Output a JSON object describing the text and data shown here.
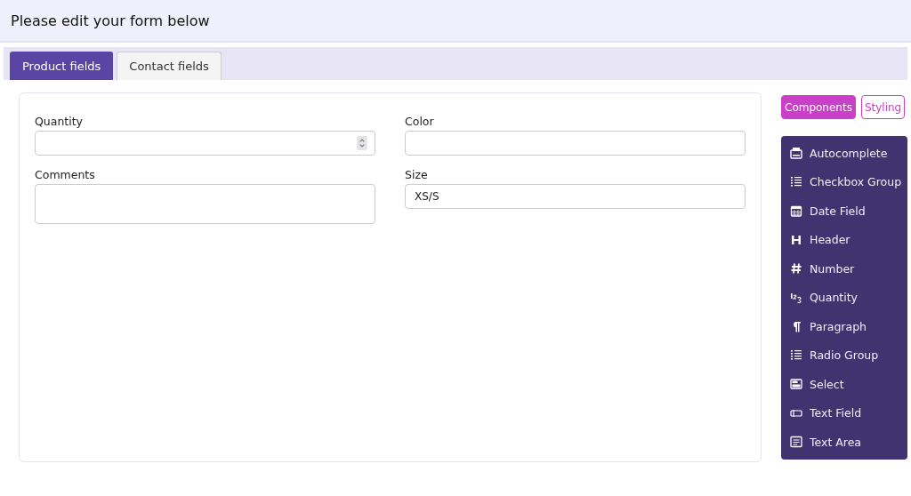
{
  "header": {
    "title": "Please edit your form below"
  },
  "tabs": [
    {
      "label": "Product fields",
      "selected": true
    },
    {
      "label": "Contact fields",
      "selected": false
    }
  ],
  "form": {
    "columns": [
      [
        {
          "label": "Quantity",
          "kind": "number"
        },
        {
          "label": "Comments",
          "kind": "textarea"
        }
      ],
      [
        {
          "label": "Color",
          "kind": "text"
        },
        {
          "label": "Size",
          "kind": "text",
          "value": "XS/S"
        }
      ]
    ]
  },
  "panel_tabs": [
    {
      "label": "Components",
      "selected": true
    },
    {
      "label": "Styling",
      "selected": false
    }
  ],
  "components": [
    {
      "label": "Autocomplete",
      "kind": "autocomplete"
    },
    {
      "label": "Checkbox Group",
      "kind": "checklist"
    },
    {
      "label": "Date Field",
      "kind": "date"
    },
    {
      "label": "Header",
      "kind": "header"
    },
    {
      "label": "Number",
      "kind": "number"
    },
    {
      "label": "Quantity",
      "kind": "quantity"
    },
    {
      "label": "Paragraph",
      "kind": "paragraph"
    },
    {
      "label": "Radio Group",
      "kind": "radiolist"
    },
    {
      "label": "Select",
      "kind": "select"
    },
    {
      "label": "Text Field",
      "kind": "textfield"
    },
    {
      "label": "Text Area",
      "kind": "textarea"
    }
  ]
}
